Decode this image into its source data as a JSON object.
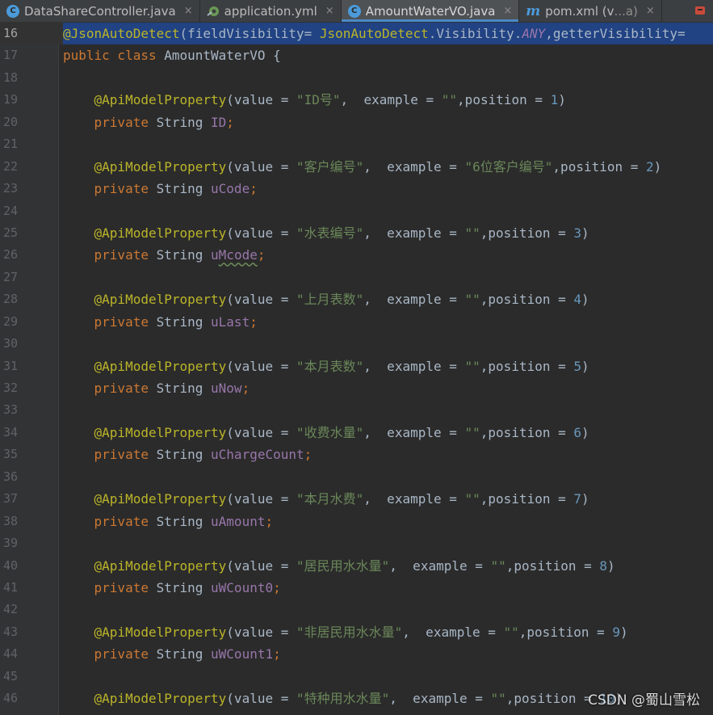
{
  "tabs": [
    {
      "label": "DataShareController.java",
      "icon": "java-class-icon",
      "active": false,
      "close": "×"
    },
    {
      "label": "application.yml",
      "icon": "yaml-config-icon",
      "active": false,
      "close": "×"
    },
    {
      "label": "AmountWaterVO.java",
      "icon": "java-class-icon",
      "active": true,
      "close": "×"
    },
    {
      "label": "pom.xml (v",
      "label_blur": "...a)",
      "icon": "maven-icon",
      "active": false,
      "close": "×"
    }
  ],
  "editor": {
    "current_line": 16,
    "lines": [
      {
        "n": "16",
        "tokens": [
          {
            "t": "@JsonAutoDetect",
            "c": "ann"
          },
          {
            "t": "(fieldVisibility= ",
            "c": "plain"
          },
          {
            "t": "JsonAutoDetect",
            "c": "ann"
          },
          {
            "t": ".Visibility.",
            "c": "plain"
          },
          {
            "t": "ANY",
            "c": "ital"
          },
          {
            "t": ",getterVisibility=",
            "c": "plain"
          }
        ]
      },
      {
        "n": "17",
        "tokens": [
          {
            "t": "public class ",
            "c": "kw"
          },
          {
            "t": "AmountWaterVO {",
            "c": "plain"
          }
        ]
      },
      {
        "n": "18",
        "tokens": []
      },
      {
        "n": "19",
        "tokens": [
          {
            "t": "    @ApiModelProperty",
            "c": "ann"
          },
          {
            "t": "(value = ",
            "c": "plain"
          },
          {
            "t": "\"ID号\"",
            "c": "str"
          },
          {
            "t": ",  example = ",
            "c": "plain"
          },
          {
            "t": "\"\"",
            "c": "str"
          },
          {
            "t": ",position = ",
            "c": "plain"
          },
          {
            "t": "1",
            "c": "num"
          },
          {
            "t": ")",
            "c": "plain"
          }
        ]
      },
      {
        "n": "20",
        "tokens": [
          {
            "t": "    private ",
            "c": "kw"
          },
          {
            "t": "String ",
            "c": "plain"
          },
          {
            "t": "ID",
            "c": "fld"
          },
          {
            "t": ";",
            "c": "kw"
          }
        ]
      },
      {
        "n": "21",
        "tokens": []
      },
      {
        "n": "22",
        "tokens": [
          {
            "t": "    @ApiModelProperty",
            "c": "ann"
          },
          {
            "t": "(value = ",
            "c": "plain"
          },
          {
            "t": "\"客户编号\"",
            "c": "str"
          },
          {
            "t": ",  example = ",
            "c": "plain"
          },
          {
            "t": "\"6位客户编号\"",
            "c": "str"
          },
          {
            "t": ",position = ",
            "c": "plain"
          },
          {
            "t": "2",
            "c": "num"
          },
          {
            "t": ")",
            "c": "plain"
          }
        ]
      },
      {
        "n": "23",
        "tokens": [
          {
            "t": "    private ",
            "c": "kw"
          },
          {
            "t": "String ",
            "c": "plain"
          },
          {
            "t": "uCode",
            "c": "fld"
          },
          {
            "t": ";",
            "c": "kw"
          }
        ]
      },
      {
        "n": "24",
        "tokens": []
      },
      {
        "n": "25",
        "tokens": [
          {
            "t": "    @ApiModelProperty",
            "c": "ann"
          },
          {
            "t": "(value = ",
            "c": "plain"
          },
          {
            "t": "\"水表编号\"",
            "c": "str"
          },
          {
            "t": ",  example = ",
            "c": "plain"
          },
          {
            "t": "\"\"",
            "c": "str"
          },
          {
            "t": ",position = ",
            "c": "plain"
          },
          {
            "t": "3",
            "c": "num"
          },
          {
            "t": ")",
            "c": "plain"
          }
        ]
      },
      {
        "n": "26",
        "tokens": [
          {
            "t": "    private ",
            "c": "kw"
          },
          {
            "t": "String ",
            "c": "plain"
          },
          {
            "t": "u",
            "c": "fld"
          },
          {
            "t": "Mcode",
            "c": "fld typo"
          },
          {
            "t": ";",
            "c": "kw"
          }
        ]
      },
      {
        "n": "27",
        "tokens": []
      },
      {
        "n": "28",
        "tokens": [
          {
            "t": "    @ApiModelProperty",
            "c": "ann"
          },
          {
            "t": "(value = ",
            "c": "plain"
          },
          {
            "t": "\"上月表数\"",
            "c": "str"
          },
          {
            "t": ",  example = ",
            "c": "plain"
          },
          {
            "t": "\"\"",
            "c": "str"
          },
          {
            "t": ",position = ",
            "c": "plain"
          },
          {
            "t": "4",
            "c": "num"
          },
          {
            "t": ")",
            "c": "plain"
          }
        ]
      },
      {
        "n": "29",
        "tokens": [
          {
            "t": "    private ",
            "c": "kw"
          },
          {
            "t": "String ",
            "c": "plain"
          },
          {
            "t": "uLast",
            "c": "fld"
          },
          {
            "t": ";",
            "c": "kw"
          }
        ]
      },
      {
        "n": "30",
        "tokens": []
      },
      {
        "n": "31",
        "tokens": [
          {
            "t": "    @ApiModelProperty",
            "c": "ann"
          },
          {
            "t": "(value = ",
            "c": "plain"
          },
          {
            "t": "\"本月表数\"",
            "c": "str"
          },
          {
            "t": ",  example = ",
            "c": "plain"
          },
          {
            "t": "\"\"",
            "c": "str"
          },
          {
            "t": ",position = ",
            "c": "plain"
          },
          {
            "t": "5",
            "c": "num"
          },
          {
            "t": ")",
            "c": "plain"
          }
        ]
      },
      {
        "n": "32",
        "tokens": [
          {
            "t": "    private ",
            "c": "kw"
          },
          {
            "t": "String ",
            "c": "plain"
          },
          {
            "t": "uNow",
            "c": "fld"
          },
          {
            "t": ";",
            "c": "kw"
          }
        ]
      },
      {
        "n": "33",
        "tokens": []
      },
      {
        "n": "34",
        "tokens": [
          {
            "t": "    @ApiModelProperty",
            "c": "ann"
          },
          {
            "t": "(value = ",
            "c": "plain"
          },
          {
            "t": "\"收费水量\"",
            "c": "str"
          },
          {
            "t": ",  example = ",
            "c": "plain"
          },
          {
            "t": "\"\"",
            "c": "str"
          },
          {
            "t": ",position = ",
            "c": "plain"
          },
          {
            "t": "6",
            "c": "num"
          },
          {
            "t": ")",
            "c": "plain"
          }
        ]
      },
      {
        "n": "35",
        "tokens": [
          {
            "t": "    private ",
            "c": "kw"
          },
          {
            "t": "String ",
            "c": "plain"
          },
          {
            "t": "uChargeCount",
            "c": "fld"
          },
          {
            "t": ";",
            "c": "kw"
          }
        ]
      },
      {
        "n": "36",
        "tokens": []
      },
      {
        "n": "37",
        "tokens": [
          {
            "t": "    @ApiModelProperty",
            "c": "ann"
          },
          {
            "t": "(value = ",
            "c": "plain"
          },
          {
            "t": "\"本月水费\"",
            "c": "str"
          },
          {
            "t": ",  example = ",
            "c": "plain"
          },
          {
            "t": "\"\"",
            "c": "str"
          },
          {
            "t": ",position = ",
            "c": "plain"
          },
          {
            "t": "7",
            "c": "num"
          },
          {
            "t": ")",
            "c": "plain"
          }
        ]
      },
      {
        "n": "38",
        "tokens": [
          {
            "t": "    private ",
            "c": "kw"
          },
          {
            "t": "String ",
            "c": "plain"
          },
          {
            "t": "uAmount",
            "c": "fld"
          },
          {
            "t": ";",
            "c": "kw"
          }
        ]
      },
      {
        "n": "39",
        "tokens": []
      },
      {
        "n": "40",
        "tokens": [
          {
            "t": "    @ApiModelProperty",
            "c": "ann"
          },
          {
            "t": "(value = ",
            "c": "plain"
          },
          {
            "t": "\"居民用水水量\"",
            "c": "str"
          },
          {
            "t": ",  example = ",
            "c": "plain"
          },
          {
            "t": "\"\"",
            "c": "str"
          },
          {
            "t": ",position = ",
            "c": "plain"
          },
          {
            "t": "8",
            "c": "num"
          },
          {
            "t": ")",
            "c": "plain"
          }
        ]
      },
      {
        "n": "41",
        "tokens": [
          {
            "t": "    private ",
            "c": "kw"
          },
          {
            "t": "String ",
            "c": "plain"
          },
          {
            "t": "uWCount0",
            "c": "fld"
          },
          {
            "t": ";",
            "c": "kw"
          }
        ]
      },
      {
        "n": "42",
        "tokens": []
      },
      {
        "n": "43",
        "tokens": [
          {
            "t": "    @ApiModelProperty",
            "c": "ann"
          },
          {
            "t": "(value = ",
            "c": "plain"
          },
          {
            "t": "\"非居民用水水量\"",
            "c": "str"
          },
          {
            "t": ",  example = ",
            "c": "plain"
          },
          {
            "t": "\"\"",
            "c": "str"
          },
          {
            "t": ",position = ",
            "c": "plain"
          },
          {
            "t": "9",
            "c": "num"
          },
          {
            "t": ")",
            "c": "plain"
          }
        ]
      },
      {
        "n": "44",
        "tokens": [
          {
            "t": "    private ",
            "c": "kw"
          },
          {
            "t": "String ",
            "c": "plain"
          },
          {
            "t": "uWCount1",
            "c": "fld"
          },
          {
            "t": ";",
            "c": "kw"
          }
        ]
      },
      {
        "n": "45",
        "tokens": []
      },
      {
        "n": "46",
        "tokens": [
          {
            "t": "    @ApiModelProperty",
            "c": "ann"
          },
          {
            "t": "(value = ",
            "c": "plain"
          },
          {
            "t": "\"特种用水水量\"",
            "c": "str"
          },
          {
            "t": ",  example = ",
            "c": "plain"
          },
          {
            "t": "\"\"",
            "c": "str"
          },
          {
            "t": ",position = ",
            "c": "plain"
          },
          {
            "t": "10",
            "c": "num"
          },
          {
            "t": ")",
            "c": "plain"
          }
        ]
      }
    ]
  },
  "watermark": "CSDN @蜀山雪松",
  "colors": {
    "background": "#2b2b2b",
    "gutter": "#313335",
    "annotation": "#bbb529",
    "keyword": "#cc7832",
    "string": "#6a8759",
    "number": "#6897bb",
    "field": "#9876aa",
    "text": "#a9b7c6",
    "accent": "#4a88c7"
  }
}
